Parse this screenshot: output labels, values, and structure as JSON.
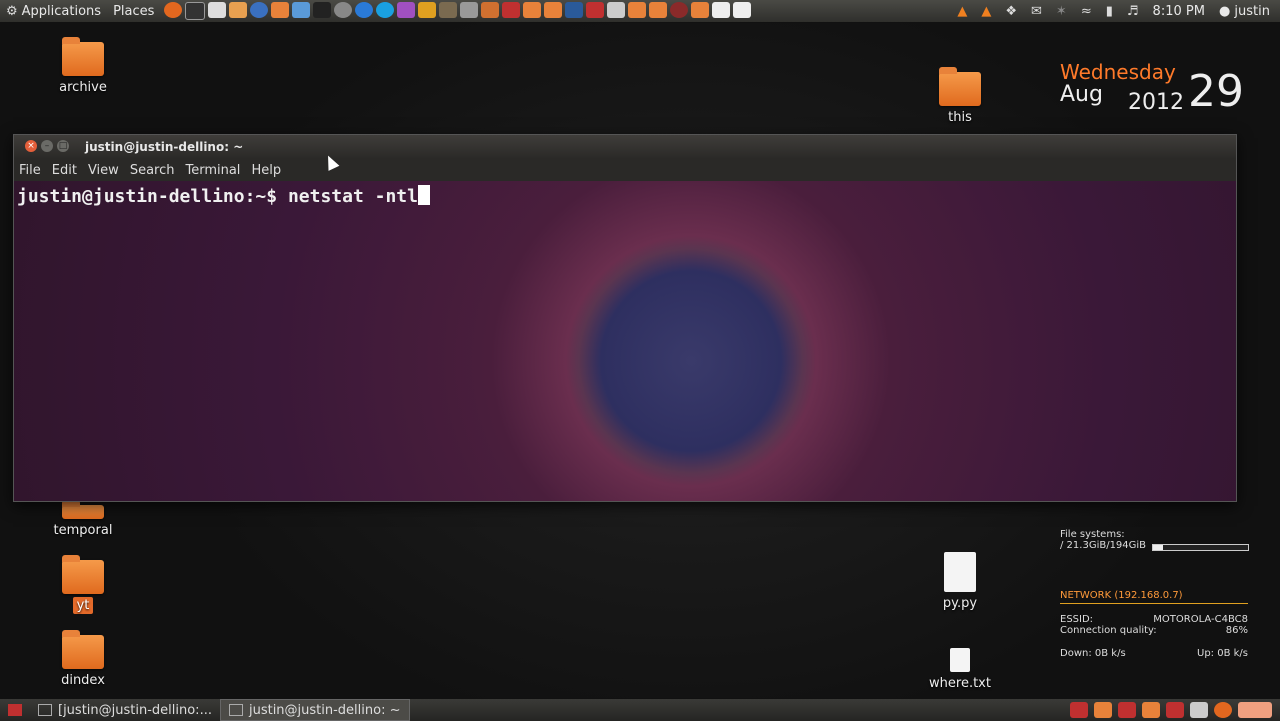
{
  "top_panel": {
    "applications": "Applications",
    "places": "Places",
    "time": "8:10 PM",
    "user": "justin"
  },
  "desktop_icons": {
    "archive": "archive",
    "this": "this",
    "temporal": "temporal",
    "yt": "yt",
    "dindex": "dindex",
    "py": "py.py",
    "where": "where.txt"
  },
  "clock": {
    "weekday": "Wednesday",
    "month": "Aug",
    "year": "2012",
    "day": "29"
  },
  "conky": {
    "fs_label": "File systems:",
    "fs_value": "/ 21.3GiB/194GiB",
    "fs_fraction": 0.11,
    "network_label": "NETWORK (192.168.0.7)",
    "essid_label": "ESSID:",
    "essid_value": "MOTOROLA-C4BC8",
    "quality_label": "Connection quality:",
    "quality_value": "86%",
    "down": "Down: 0B k/s",
    "up": "Up: 0B k/s"
  },
  "terminal": {
    "title": "justin@justin-dellino: ~",
    "menu": [
      "File",
      "Edit",
      "View",
      "Search",
      "Terminal",
      "Help"
    ],
    "prompt": "justin@justin-dellino:~$ ",
    "command": "netstat -ntl"
  },
  "taskbar": {
    "task1": "[justin@justin-dellino:...",
    "task2": "justin@justin-dellino: ~"
  },
  "colors": {
    "accent": "#ff7a2a",
    "terminal_bg": "#2c1a28"
  }
}
